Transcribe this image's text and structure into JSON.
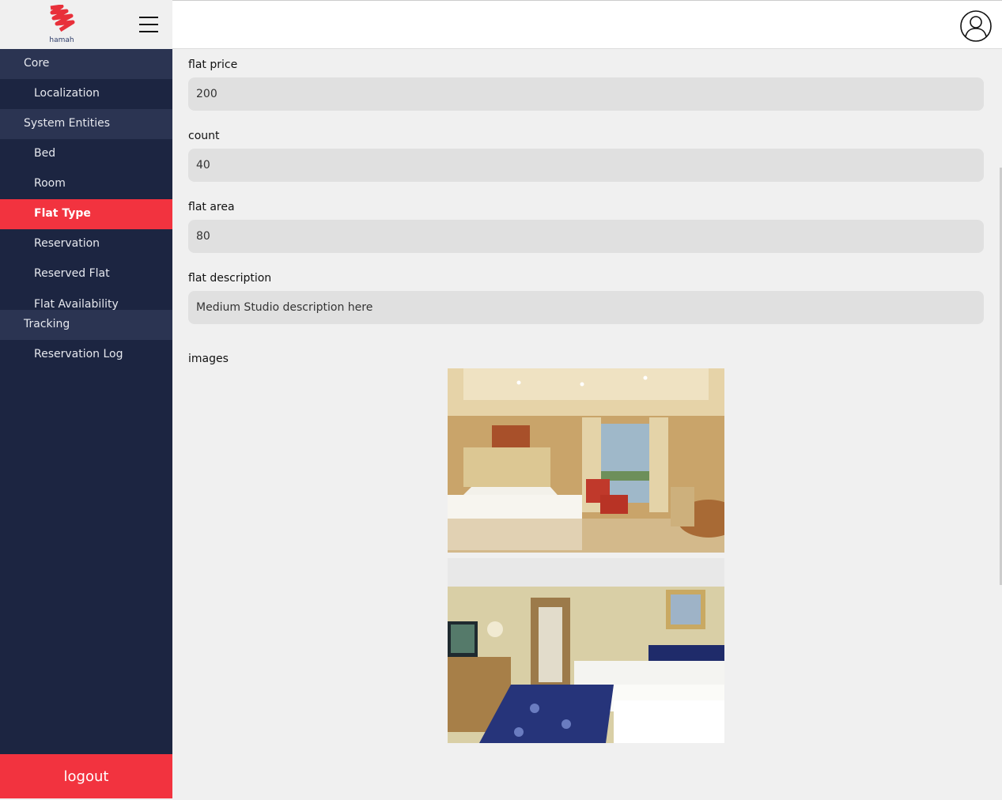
{
  "brand": {
    "logo_text": "hamah"
  },
  "sidebar": {
    "groups": [
      {
        "label": "Core",
        "items": [
          {
            "label": "Localization"
          }
        ]
      },
      {
        "label": "System Entities",
        "items": [
          {
            "label": "Bed"
          },
          {
            "label": "Room"
          },
          {
            "label": "Flat Type",
            "active": true
          },
          {
            "label": "Reservation"
          },
          {
            "label": "Reserved Flat"
          },
          {
            "label": "Flat Availability"
          }
        ]
      },
      {
        "label": "Tracking",
        "items": [
          {
            "label": "Reservation Log"
          }
        ]
      }
    ],
    "logout_label": "logout"
  },
  "form": {
    "flat_price": {
      "label": "flat price",
      "value": "200"
    },
    "count": {
      "label": "count",
      "value": "40"
    },
    "flat_area": {
      "label": "flat area",
      "value": "80"
    },
    "flat_description": {
      "label": "flat description",
      "value": "Medium Studio description here"
    },
    "images_label": "images"
  },
  "colors": {
    "sidebar_bg": "#1c2541",
    "group_bg": "#2b3452",
    "accent": "#f2333f"
  }
}
